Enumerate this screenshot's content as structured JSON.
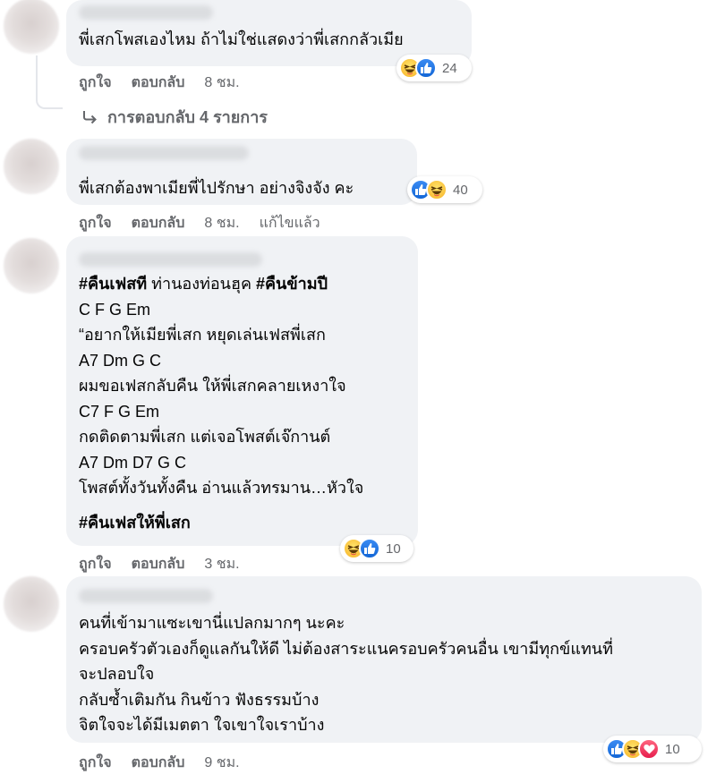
{
  "comments": [
    {
      "lines": [
        "พี่เสกโพสเองไหม ถ้าไม่ใช่แสดงว่าพี่เสกกลัวเมีย"
      ],
      "reactions": [
        "haha-icon",
        "like-icon"
      ],
      "reaction_count": "24",
      "like_label": "ถูกใจ",
      "reply_label": "ตอบกลับ",
      "time": "8 ชม.",
      "replies_label": "การตอบกลับ 4 รายการ"
    },
    {
      "lines": [
        "พี่เสกต้องพาเมียพี่ไปรักษา อย่างจิงจัง คะ"
      ],
      "reactions": [
        "like-icon",
        "haha-icon"
      ],
      "reaction_count": "40",
      "like_label": "ถูกใจ",
      "reply_label": "ตอบกลับ",
      "time": "8 ชม.",
      "edited": "แก้ไขแล้ว"
    },
    {
      "line1_tag1": "#คืนเฟสที",
      "line1_mid": " ท่านองท่อนฮุค ",
      "line1_tag2": "#คืนข้ามปี",
      "lines": [
        "C F G Em",
        "“อยากให้เมียพี่เสก หยุดเล่นเฟสพี่เสก",
        "A7 Dm G C",
        "ผมขอเฟสกลับคืน ให้พี่เสกคลายเหงาใจ",
        "C7 F G Em",
        "กดติดตามพี่เสก แต่เจอโพสต์เจ๊กานต์",
        "A7 Dm D7 G C",
        "โพสต์ทั้งวันทั้งคืน อ่านแล้วทรมาน…หัวใจ"
      ],
      "hashtag_end": "#คืนเฟสให้พี่เสก",
      "reactions": [
        "haha-icon",
        "like-icon"
      ],
      "reaction_count": "10",
      "like_label": "ถูกใจ",
      "reply_label": "ตอบกลับ",
      "time": "3 ชม."
    },
    {
      "lines": [
        "คนที่เข้ามาแซะเขานี่แปลกมากๆ นะคะ",
        "ครอบครัวตัวเองก็ดูแลกันให้ดี ไม่ต้องสาระแนครอบครัวคนอื่น เขามีทุกข์แทนที่",
        "จะปลอบใจ",
        "กลับซ้ำเติมกัน กินข้าว ฟังธรรมบ้าง",
        "จิตใจจะได้มีเมตตา ใจเขาใจเราบ้าง"
      ],
      "reactions": [
        "like-icon",
        "haha-icon",
        "love-icon"
      ],
      "reaction_count": "10",
      "like_label": "ถูกใจ",
      "reply_label": "ตอบกลับ",
      "time": "9 ชม."
    }
  ]
}
